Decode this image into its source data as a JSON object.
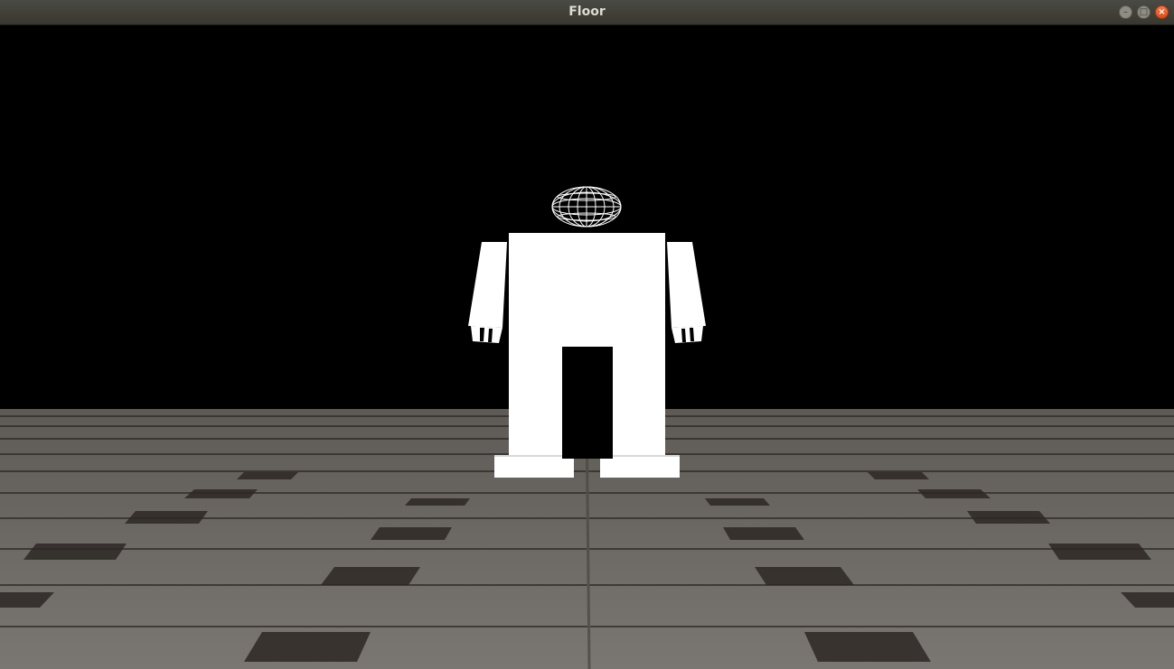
{
  "window": {
    "title": "Floor",
    "controls": {
      "minimize_icon": "minimize-icon",
      "maximize_icon": "maximize-icon",
      "close_icon": "close-icon"
    }
  },
  "scene": {
    "background_color": "#000000",
    "floor_color": "#6f6b66",
    "figure_color": "#ffffff"
  }
}
